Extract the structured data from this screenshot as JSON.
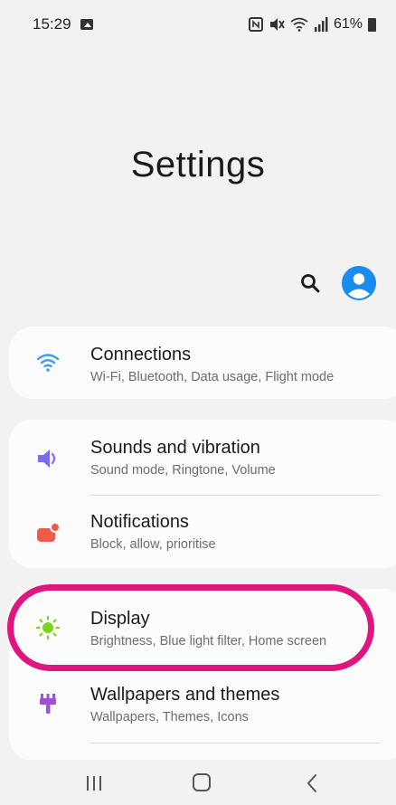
{
  "status_bar": {
    "time": "15:29",
    "battery": "61%",
    "icons": [
      "image-icon",
      "nfc-icon",
      "mute-icon",
      "wifi-icon",
      "signal-icon",
      "battery-icon"
    ]
  },
  "page": {
    "title": "Settings"
  },
  "header_actions": {
    "search_icon": "search-icon",
    "avatar_icon": "account-avatar"
  },
  "settings_items": [
    {
      "title": "Connections",
      "subtitle": "Wi-Fi, Bluetooth, Data usage, Flight mode",
      "icon": "wifi-icon",
      "icon_color": "#3d9df5"
    },
    {
      "title": "Sounds and vibration",
      "subtitle": "Sound mode, Ringtone, Volume",
      "icon": "speaker-icon",
      "icon_color": "#7c6cf0"
    },
    {
      "title": "Notifications",
      "subtitle": "Block, allow, prioritise",
      "icon": "notification-icon",
      "icon_color": "#f05a4a"
    },
    {
      "title": "Display",
      "subtitle": "Brightness, Blue light filter, Home screen",
      "icon": "sun-icon",
      "icon_color": "#7ed321"
    },
    {
      "title": "Wallpapers and themes",
      "subtitle": "Wallpapers, Themes, Icons",
      "icon": "paintbrush-icon",
      "icon_color": "#a24fd8"
    }
  ],
  "annotation": {
    "highlight_color": "#e0157f",
    "highlighted_item": "Display"
  },
  "nav_bar": {
    "buttons": [
      "recent-apps",
      "home",
      "back"
    ]
  }
}
